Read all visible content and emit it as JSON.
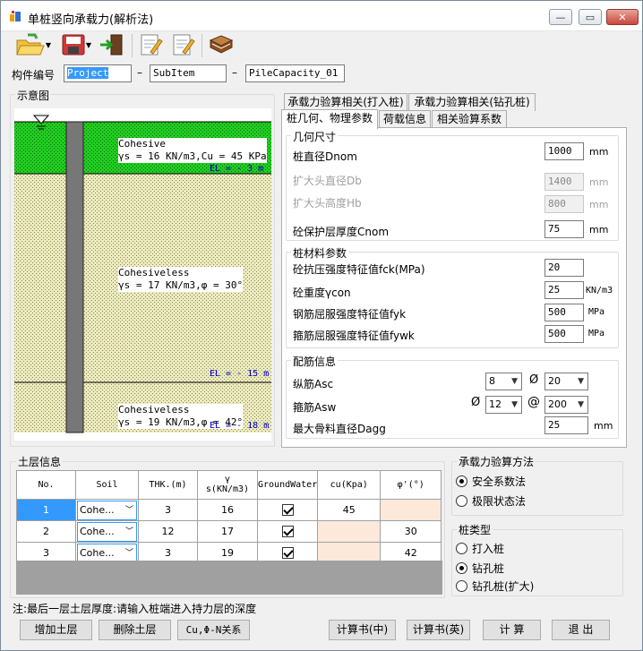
{
  "window": {
    "title": "单桩竖向承载力(解析法)",
    "min_glyph": "—",
    "max_glyph": "▭",
    "close_glyph": "✕"
  },
  "toolbar": {
    "icons": [
      "open-folder-icon",
      "save-disk-icon",
      "exit-door-icon",
      "edit-note-icon",
      "edit-note-2-icon",
      "book-icon"
    ]
  },
  "component": {
    "label": "构件编号",
    "field1": "Project",
    "sep1": "–",
    "field2": "SubItem",
    "sep2": "–",
    "field3": "PileCapacity_01"
  },
  "diagram": {
    "title": "示意图",
    "layers": [
      {
        "name": "Cohesive",
        "props": "γs = 16 KN/m3,Cu = 45 KPa",
        "el": "EL = - 3 m",
        "color": "#22cc22"
      },
      {
        "name": "Cohesiveless",
        "props": "γs = 17 KN/m3,φ = 30°",
        "el": "EL = - 15 m",
        "color": "#ece9c4"
      },
      {
        "name": "Cohesiveless",
        "props": "γs = 19 KN/m3,φ = 42°",
        "el": "EL = - 18 m",
        "color": "#ece9c4"
      }
    ]
  },
  "tabs": {
    "row1": [
      "承载力验算相关(打入桩)",
      "承载力验算相关(钻孔桩)"
    ],
    "row2": [
      "桩几何、物理参数",
      "荷载信息",
      "相关验算系数"
    ]
  },
  "geometry": {
    "title": "几何尺寸",
    "fields": [
      {
        "label": "桩直径Dnom",
        "value": "1000",
        "unit": "mm",
        "enabled": true
      },
      {
        "label": "扩大头直径Db",
        "value": "1400",
        "unit": "mm",
        "enabled": false
      },
      {
        "label": "扩大头高度Hb",
        "value": "800",
        "unit": "mm",
        "enabled": false
      },
      {
        "label": "砼保护层厚度Cnom",
        "value": "75",
        "unit": "mm",
        "enabled": true
      }
    ]
  },
  "material": {
    "title": "桩材料参数",
    "fields": [
      {
        "label": "砼抗压强度特征值fck(MPa)",
        "value": "20",
        "unit": ""
      },
      {
        "label": "砼重度γcon",
        "value": "25",
        "unit": "KN/m3"
      },
      {
        "label": "钢筋屈服强度特征值fyk",
        "value": "500",
        "unit": "MPa"
      },
      {
        "label": "箍筋屈服强度特征值fywk",
        "value": "500",
        "unit": "MPa"
      }
    ]
  },
  "rebar": {
    "title": "配筋信息",
    "asc_label": "纵筋Asc",
    "asc_count": "8",
    "asc_phi": "Ø",
    "asc_dia": "20",
    "asw_label": "箍筋Asw",
    "asw_phi": "Ø",
    "asw_dia": "12",
    "asw_at": "@",
    "asw_spacing": "200",
    "dagg_label": "最大骨料直径Dagg",
    "dagg_value": "25",
    "dagg_unit": "mm"
  },
  "soil": {
    "title": "土层信息",
    "headers": [
      "No.",
      "Soil",
      "THK.(m)",
      "γ",
      "s(KN/m3)",
      "GroundWater",
      "cu(Kpa)",
      "φ'(°)"
    ],
    "rows": [
      {
        "no": "1",
        "soil": "Cohe...",
        "thk": "3",
        "gamma": "16",
        "gw": true,
        "cu": "45",
        "phi": ""
      },
      {
        "no": "2",
        "soil": "Cohe...",
        "thk": "12",
        "gamma": "17",
        "gw": true,
        "cu": "",
        "phi": "30"
      },
      {
        "no": "3",
        "soil": "Cohe...",
        "thk": "3",
        "gamma": "19",
        "gw": true,
        "cu": "",
        "phi": "42"
      }
    ]
  },
  "method": {
    "title": "承载力验算方法",
    "options": [
      "安全系数法",
      "极限状态法"
    ],
    "selected": 0
  },
  "piletype": {
    "title": "桩类型",
    "options": [
      "打入桩",
      "钻孔桩",
      "钻孔桩(扩大)"
    ],
    "selected": 1
  },
  "note": "注:最后一层土层厚度:请输入桩端进入持力层的深度",
  "buttons": {
    "add": "增加土层",
    "delete": "删除土层",
    "relation": "Cu,Φ-N关系",
    "calc_cn": "计算书(中)",
    "calc_en": "计算书(英)",
    "compute": "计 算",
    "exit": "退 出"
  }
}
